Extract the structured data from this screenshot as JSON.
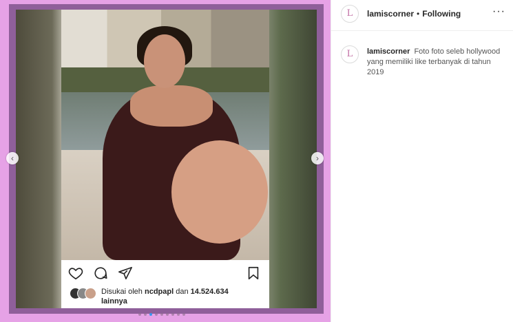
{
  "post": {
    "liked_by_prefix": "Disukai oleh",
    "liked_by_user": "ncdpapl",
    "liked_by_and": "dan",
    "like_count": "14.524.634",
    "liked_by_suffix": "lainnya",
    "carousel_prev_icon": "chevron-left-icon",
    "carousel_next_icon": "chevron-right-icon",
    "carousel_total": 9,
    "carousel_active_index": 2
  },
  "header": {
    "username": "lamiscorner",
    "separator": "•",
    "follow_status": "Following",
    "avatar_letter": "L",
    "more_icon": "ellipsis-icon"
  },
  "caption": {
    "username": "lamiscorner",
    "text": "Foto foto seleb hollywood yang memiliki like terbanyak di tahun 2019"
  },
  "colors": {
    "frame_pink": "#e6a2e6",
    "frame_purple": "#8f5f9a",
    "accent_blue": "#3897f0"
  }
}
